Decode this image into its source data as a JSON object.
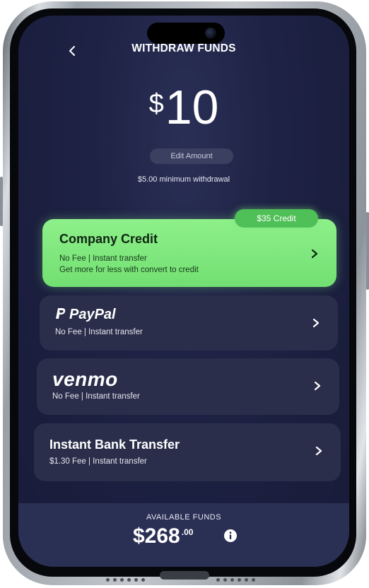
{
  "header": {
    "title": "WITHDRAW FUNDS"
  },
  "amount": {
    "currency": "$",
    "value": "10",
    "edit_label": "Edit Amount",
    "minimum_note": "$5.00 minimum withdrawal"
  },
  "options": {
    "credit": {
      "badge": "$35 Credit",
      "title": "Company Credit",
      "line1": "No Fee  |  Instant transfer",
      "line2": "Get more for less with convert to credit"
    },
    "paypal": {
      "logo": "PayPal",
      "line1": "No Fee  |  Instant transfer"
    },
    "venmo": {
      "logo": "venmo",
      "line1": "No Fee  |  Instant transfer"
    },
    "bank": {
      "title": "Instant Bank Transfer",
      "line1": "$1.30 Fee  |  Instant transfer"
    }
  },
  "footer": {
    "label": "AVAILABLE FUNDS",
    "amount": "$268",
    "cents": ".00"
  },
  "icons": {
    "back": "chevron-left-icon",
    "chevron": "chevron-right-icon",
    "info": "info-icon",
    "paypal_mark": "paypal-p-icon"
  },
  "colors": {
    "background": "#1e2244",
    "card": "#2a2e4a",
    "credit_green": "#7fe87d",
    "badge_green": "#4fbf57",
    "footer": "#2a2f54"
  }
}
